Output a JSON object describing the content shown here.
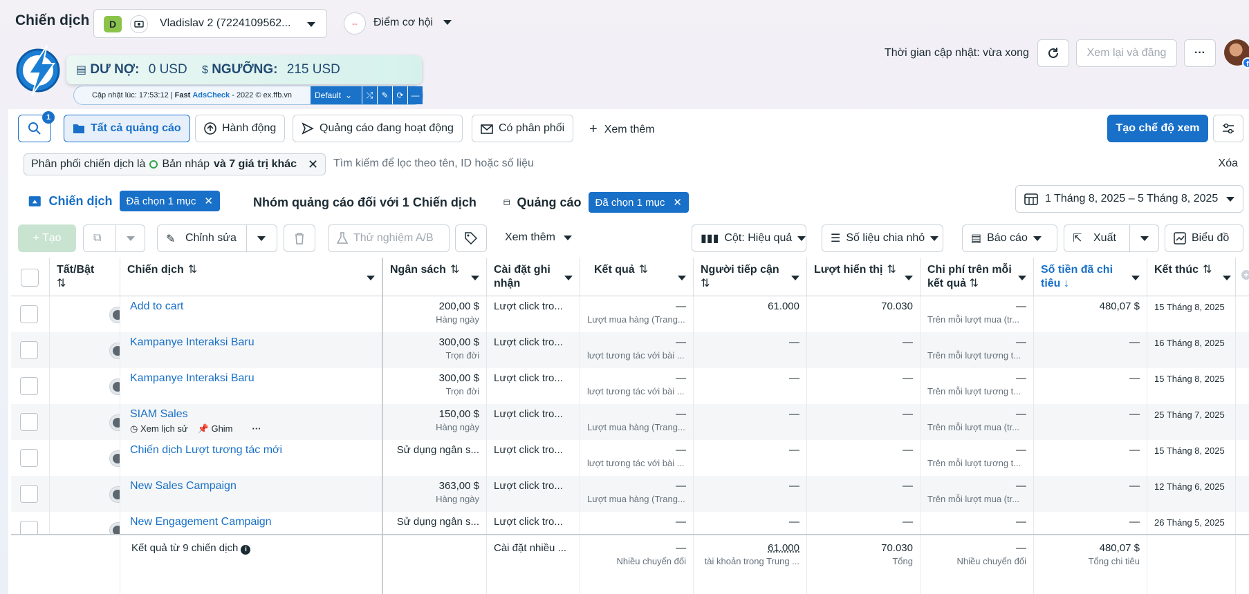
{
  "header": {
    "title": "Chiến dịch",
    "account_badge": "D",
    "account_name": "Vladislav 2 (7224109562...",
    "opportunity_circle": "--",
    "opportunity_label": "Điểm cơ hội",
    "update_time": "Thời gian cập nhật: vừa xong",
    "review_publish": "Xem lại và đăng",
    "more": "···"
  },
  "adscheck": {
    "debt_label": "DƯ NỢ:",
    "debt_value": "0 USD",
    "threshold_label": "NGƯỠNG:",
    "threshold_value": "215 USD",
    "updated_at": "Cập nhật lúc: 17:53:12 |",
    "brand_fast": "Fast",
    "brand_name": "AdsCheck",
    "brand_suffix": "- 2022 © ex.ffb.vn",
    "profile": "Default"
  },
  "toolbar": {
    "search_badge": "1",
    "all_ads": "Tất cả quảng cáo",
    "actions": "Hành động",
    "active_ads": "Quảng cáo đang hoạt động",
    "has_delivery": "Có phân phối",
    "see_more": "Xem thêm",
    "create_view": "Tạo chế độ xem"
  },
  "filter": {
    "chip_prefix": "Phân phối chiến dịch là",
    "chip_value": "Bản nháp",
    "chip_more": "và 7 giá trị khác",
    "search_placeholder": "Tìm kiếm để lọc theo tên, ID hoặc số liệu",
    "clear": "Xóa"
  },
  "tabs": {
    "campaign": "Chiến dịch",
    "campaign_chip": "Đã chọn 1 mục",
    "adset": "Nhóm quảng cáo đối với 1 Chiến dịch",
    "ads": "Quảng cáo",
    "ads_chip": "Đã chọn 1 mục",
    "date_range": "1 Tháng 8, 2025 – 5 Tháng 8, 2025"
  },
  "actions": {
    "create": "+ Tạo",
    "edit": "Chỉnh sửa",
    "ab_test": "Thử nghiệm A/B",
    "see_more": "Xem thêm",
    "columns": "Cột: Hiệu quả",
    "breakdown": "Số liệu chia nhỏ",
    "reports": "Báo cáo",
    "export": "Xuất",
    "charts": "Biểu đồ"
  },
  "columns": {
    "toggle": "Tất/Bật",
    "campaign": "Chiến dịch",
    "budget": "Ngân sách",
    "attribution": "Cài đặt ghi nhận",
    "results": "Kết quả",
    "reach": "Người tiếp cận",
    "impressions": "Lượt hiển thị",
    "cpr": "Chi phí trên mỗi kết quả",
    "spent": "Số tiền đã chi tiêu",
    "ends": "Kết thúc"
  },
  "rows": [
    {
      "name": "Add to cart",
      "budget": "200,00 $",
      "budget_type": "Hàng ngày",
      "attribution": "Lượt click tro...",
      "results": "—",
      "results_sub": "Lượt mua hàng (Trang...",
      "reach": "61.000",
      "impressions": "70.030",
      "cpr": "—",
      "cpr_sub": "Trên mỗi lượt mua (tr...",
      "spent": "480,07 $",
      "ends": "15 Tháng 8, 2025"
    },
    {
      "name": "Kampanye Interaksi Baru",
      "budget": "300,00 $",
      "budget_type": "Trọn đời",
      "attribution": "Lượt click tro...",
      "results": "—",
      "results_sub": "lượt tương tác với bài ...",
      "reach": "—",
      "impressions": "—",
      "cpr": "—",
      "cpr_sub": "Trên mỗi lượt tương t...",
      "spent": "—",
      "ends": "16 Tháng 8, 2025"
    },
    {
      "name": "Kampanye Interaksi Baru",
      "budget": "300,00 $",
      "budget_type": "Trọn đời",
      "attribution": "Lượt click tro...",
      "results": "—",
      "results_sub": "lượt tương tác với bài ...",
      "reach": "—",
      "impressions": "—",
      "cpr": "—",
      "cpr_sub": "Trên mỗi lượt tương t...",
      "spent": "—",
      "ends": "15 Tháng 8, 2025"
    },
    {
      "name": "SIAM Sales",
      "budget": "150,00 $",
      "budget_type": "Hàng ngày",
      "attribution": "Lượt click tro...",
      "results": "—",
      "results_sub": "Lượt mua hàng (Trang...",
      "reach": "—",
      "impressions": "—",
      "cpr": "—",
      "cpr_sub": "Trên mỗi lượt mua (tr...",
      "spent": "—",
      "ends": "25 Tháng 7, 2025",
      "hover_history": "Xem lịch sử",
      "hover_pin": "Ghim",
      "hover_more": "···"
    },
    {
      "name": "Chiến dịch Lượt tương tác mới",
      "budget": "Sử dụng ngân s...",
      "budget_type": "",
      "attribution": "Lượt click tro...",
      "results": "—",
      "results_sub": "lượt tương tác với bài ...",
      "reach": "—",
      "impressions": "—",
      "cpr": "—",
      "cpr_sub": "Trên mỗi lượt tương t...",
      "spent": "—",
      "ends": "15 Tháng 8, 2025"
    },
    {
      "name": "New Sales Campaign",
      "budget": "363,00 $",
      "budget_type": "Hàng ngày",
      "attribution": "Lượt click tro...",
      "results": "—",
      "results_sub": "Lượt mua hàng (Trang...",
      "reach": "—",
      "impressions": "—",
      "cpr": "—",
      "cpr_sub": "Trên mỗi lượt mua (tr...",
      "spent": "—",
      "ends": "12 Tháng 6, 2025"
    },
    {
      "name": "New Engagement Campaign",
      "budget": "Sử dụng ngân s...",
      "budget_type": "",
      "attribution": "Lượt click tro...",
      "results": "—",
      "results_sub": "",
      "reach": "—",
      "impressions": "—",
      "cpr": "—",
      "cpr_sub": "",
      "spent": "—",
      "ends": "26 Tháng 5, 2025"
    }
  ],
  "footer": {
    "summary": "Kết quả từ 9 chiến dịch",
    "attribution": "Cài đặt nhiều ...",
    "results": "—",
    "results_sub": "Nhiều chuyển đổi",
    "reach": "61.000",
    "reach_sub": "tài khoản trong Trung ...",
    "impressions": "70.030",
    "impressions_sub": "Tổng",
    "cpr": "—",
    "cpr_sub": "Nhiều chuyển đổi",
    "spent": "480,07 $",
    "spent_sub": "Tổng chi tiêu"
  }
}
